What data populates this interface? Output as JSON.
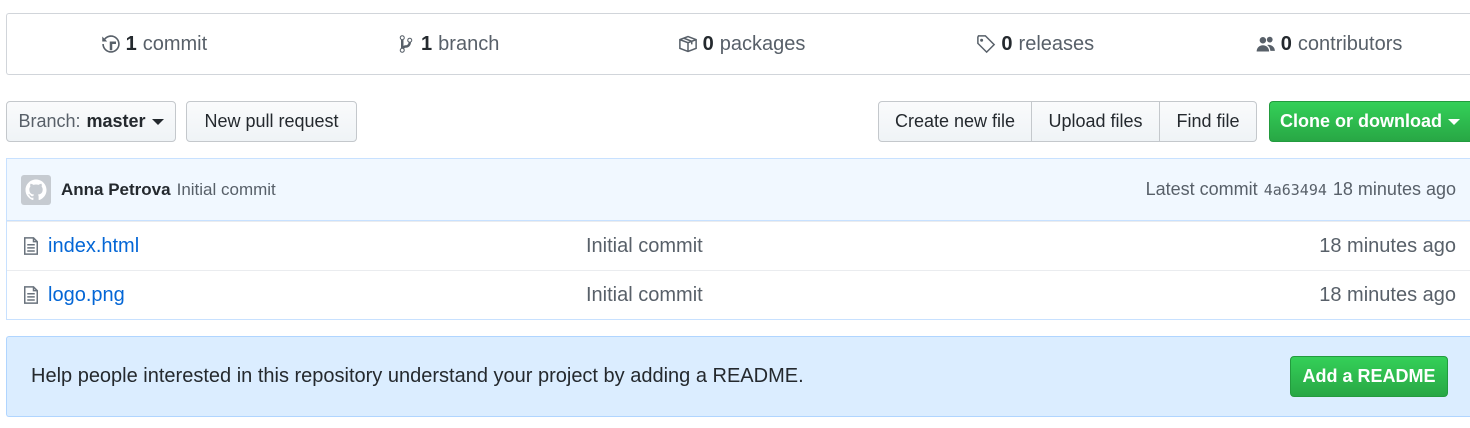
{
  "summary": {
    "commits": {
      "count": "1",
      "label": "commit",
      "icon": "history-icon"
    },
    "branches": {
      "count": "1",
      "label": "branch",
      "icon": "git-branch-icon"
    },
    "packages": {
      "count": "0",
      "label": "packages",
      "icon": "package-icon"
    },
    "releases": {
      "count": "0",
      "label": "releases",
      "icon": "tag-icon"
    },
    "contributors": {
      "count": "0",
      "label": "contributors",
      "icon": "people-icon"
    }
  },
  "toolbar": {
    "branch_prefix": "Branch:",
    "branch_name": "master",
    "new_pull_request": "New pull request",
    "create_new_file": "Create new file",
    "upload_files": "Upload files",
    "find_file": "Find file",
    "clone_or_download": "Clone or download"
  },
  "latest_commit": {
    "author": "Anna Petrova",
    "message": "Initial commit",
    "prefix": "Latest commit",
    "sha": "4a63494",
    "age": "18 minutes ago"
  },
  "files": [
    {
      "name": "index.html",
      "message": "Initial commit",
      "age": "18 minutes ago",
      "icon": "file-icon"
    },
    {
      "name": "logo.png",
      "message": "Initial commit",
      "age": "18 minutes ago",
      "icon": "file-icon"
    }
  ],
  "readme_prompt": {
    "text": "Help people interested in this repository understand your project by adding a README.",
    "button": "Add a README"
  },
  "colors": {
    "link": "#0366d6",
    "primary_green": "#28a745",
    "commit_bar_bg": "#f1f8ff",
    "readme_bg": "#dbedff"
  }
}
